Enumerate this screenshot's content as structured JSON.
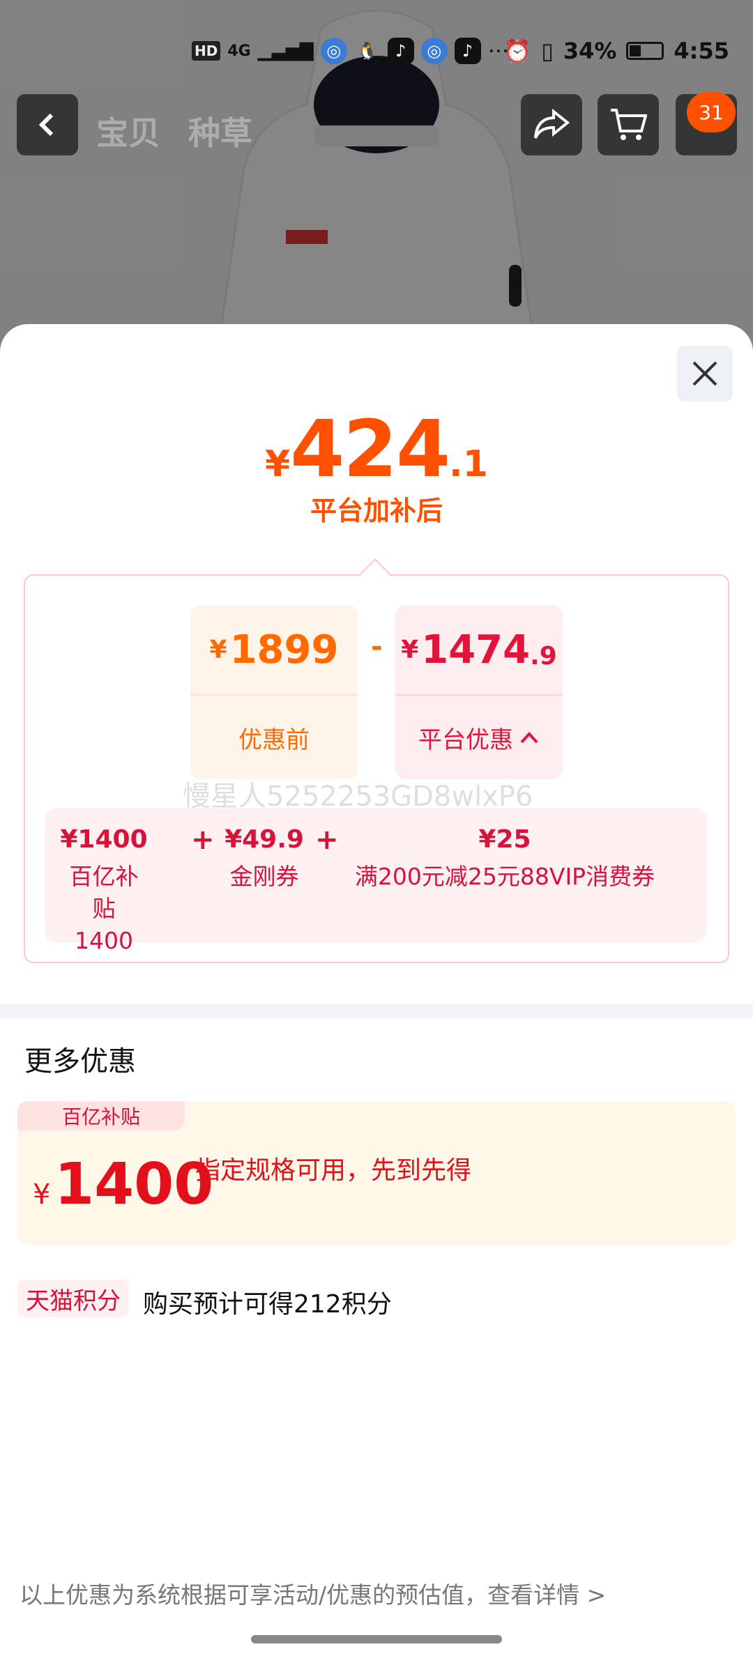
{
  "status_bar": {
    "network": "HD",
    "signal": "4G",
    "battery": "34%",
    "time": "4:55",
    "more": "···"
  },
  "nav": {
    "tabs": [
      "宝贝",
      "种草"
    ],
    "cart_badge": "31"
  },
  "sheet": {
    "price": {
      "currency": "¥",
      "integer": "424",
      "decimal": ".1"
    },
    "price_caption": "平台加补后",
    "before": {
      "currency": "¥",
      "value": "1899",
      "label": "优惠前"
    },
    "operator": "-",
    "platform": {
      "currency": "¥",
      "value": "1474",
      "decimal": ".9",
      "label": "平台优惠",
      "chevron": "^"
    },
    "watermark": "慢星人5252253GD8wlxP6",
    "breakdown": [
      {
        "amount": "¥1400",
        "name": "百亿补贴\n1400"
      },
      {
        "amount": "¥49.9",
        "name": "金刚券"
      },
      {
        "amount": "¥25",
        "name": "满200元减25元88VIP消费券"
      }
    ],
    "plus": "+",
    "more_title": "更多优惠",
    "subsidy": {
      "tag": "百亿补贴",
      "currency": "¥",
      "amount": "1400",
      "desc": "指定规格可用，先到先得"
    },
    "points": {
      "tag": "天猫积分",
      "text": "购买预计可得212积分"
    },
    "footer": "以上优惠为系统根据可享活动/优惠的预估值，查看详情 >"
  },
  "colors": {
    "accent_orange": "#ff5000",
    "discount_red": "#e3143c"
  }
}
